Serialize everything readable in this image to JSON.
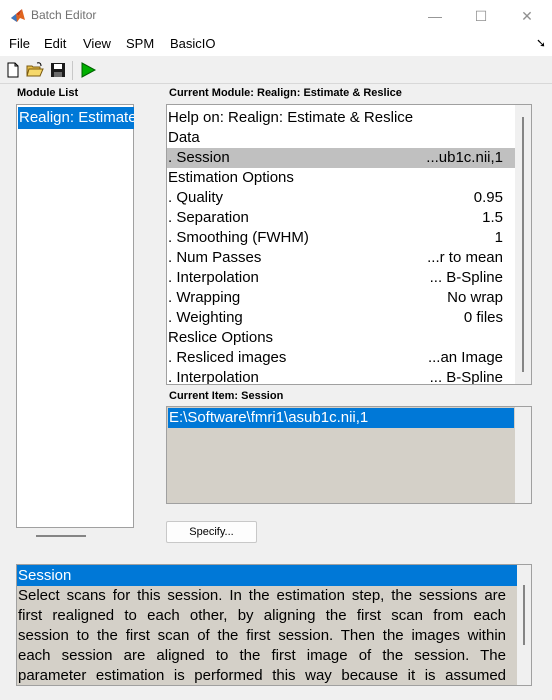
{
  "window": {
    "title": "Batch Editor",
    "controls": {
      "minimize": "—",
      "maximize": "☐",
      "close": "✕"
    }
  },
  "menu": {
    "items": [
      "File",
      "Edit",
      "View",
      "SPM",
      "BasicIO"
    ],
    "overflow_arrow": "➘"
  },
  "toolbar": {
    "icons": [
      "new-file-icon",
      "open-folder-icon",
      "save-icon",
      "run-icon"
    ],
    "colors": {
      "run": "#00a000"
    }
  },
  "module_list": {
    "label": "Module List",
    "items": [
      "Realign: Estimate & Reslice"
    ],
    "selected_color": "#0078d7"
  },
  "current_module": {
    "label": "Current Module: Realign: Estimate & Reslice",
    "rows": [
      {
        "key": "Help on: Realign: Estimate & Reslice",
        "value": ""
      },
      {
        "key": "Data",
        "value": ""
      },
      {
        "key": ". Session",
        "value": "...ub1c.nii,1",
        "selected": true
      },
      {
        "key": "Estimation Options",
        "value": ""
      },
      {
        "key": ". Quality",
        "value": "0.95"
      },
      {
        "key": ". Separation",
        "value": "1.5"
      },
      {
        "key": ". Smoothing (FWHM)",
        "value": "1"
      },
      {
        "key": ". Num Passes",
        "value": "...r to mean"
      },
      {
        "key": ". Interpolation",
        "value": "... B-Spline"
      },
      {
        "key": ". Wrapping",
        "value": "No wrap"
      },
      {
        "key": ". Weighting",
        "value": "0 files"
      },
      {
        "key": "Reslice Options",
        "value": ""
      },
      {
        "key": ". Resliced images",
        "value": "...an Image"
      },
      {
        "key": ". Interpolation",
        "value": "... B-Spline"
      }
    ]
  },
  "current_item": {
    "label": "Current Item: Session",
    "values": [
      "E:\\Software\\fmri1\\asub1c.nii,1"
    ]
  },
  "specify_button": "Specify...",
  "help": {
    "title": "Session",
    "lines": [
      "Select scans for this session. In the estimation step, the sessions are",
      "first realigned to each other, by aligning the first scan from each",
      "session to the first scan of the first session. Then the images within",
      "each session are aligned to the first image of the session. The",
      "parameter estimation is performed this way because it is assumed"
    ]
  }
}
